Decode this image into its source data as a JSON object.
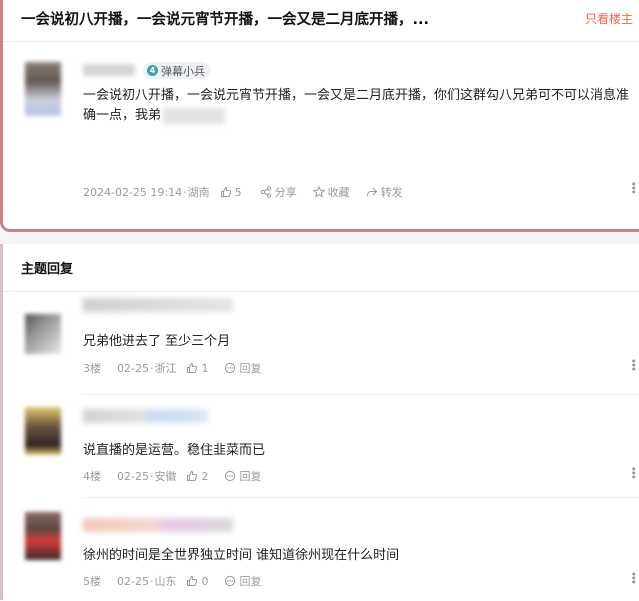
{
  "thread": {
    "title": "一会说初八开播，一会说元宵节开播，一会又是二月底开播，...",
    "only_op": "只看楼主"
  },
  "op_post": {
    "badge_level": "4",
    "badge_label": "弹幕小兵",
    "content": "一会说初八开播，一会说元宵节开播，一会又是二月底开播，你们这群勾八兄弟可不可以消息准确一点，我弟",
    "date": "2024-02-25 19:14",
    "sep": "·",
    "location": "湖南",
    "likes": "5",
    "share_label": "分享",
    "collect_label": "收藏",
    "forward_label": "转发"
  },
  "replies_section": {
    "title": "主题回复",
    "items": [
      {
        "floor": "3楼",
        "date": "02-25",
        "sep": "·",
        "location": "浙江",
        "likes": "1",
        "reply_label": "回复",
        "content": "兄弟他进去了 至少三个月"
      },
      {
        "floor": "4楼",
        "date": "02-25",
        "sep": "·",
        "location": "安徽",
        "likes": "2",
        "reply_label": "回复",
        "content": "说直播的是运营。稳住韭菜而已"
      },
      {
        "floor": "5楼",
        "date": "02-25",
        "sep": "·",
        "location": "山东",
        "likes": "0",
        "reply_label": "回复",
        "content": "徐州的时间是全世界独立时间 谁知道徐州现在什么时间"
      }
    ]
  },
  "colors": {
    "accent": "#e46b4f",
    "card_border": "#c58585",
    "badge_bg": "#eef2f7",
    "badge_icon": "#3aa6a0"
  },
  "icons": [
    "thumbs-up-icon",
    "share-icon",
    "star-icon",
    "forward-icon",
    "comment-icon",
    "more-icon"
  ]
}
